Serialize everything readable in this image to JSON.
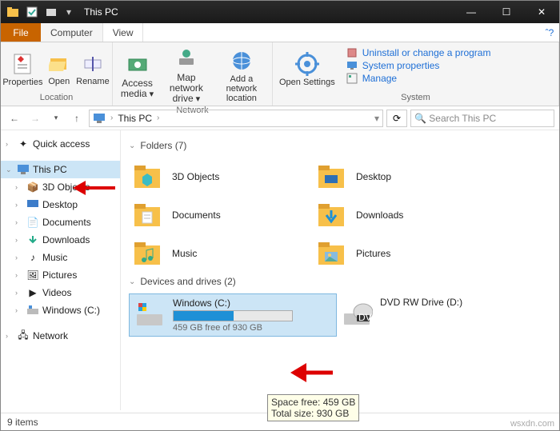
{
  "title": "This PC",
  "tabs": {
    "file": "File",
    "computer": "Computer",
    "view": "View"
  },
  "ribbon": {
    "location": {
      "label": "Location",
      "properties": "Properties",
      "open": "Open",
      "rename": "Rename"
    },
    "network": {
      "label": "Network",
      "access": "Access media",
      "map": "Map network drive",
      "add": "Add a network location"
    },
    "system": {
      "label": "System",
      "settings": "Open Settings",
      "uninstall": "Uninstall or change a program",
      "sysprops": "System properties",
      "manage": "Manage"
    }
  },
  "address": {
    "root": "This PC",
    "search_placeholder": "Search This PC"
  },
  "tree": {
    "quick": "Quick access",
    "thispc": "This PC",
    "3d": "3D Objects",
    "desktop": "Desktop",
    "documents": "Documents",
    "downloads": "Downloads",
    "music": "Music",
    "pictures": "Pictures",
    "videos": "Videos",
    "windows": "Windows (C:)",
    "network": "Network"
  },
  "sections": {
    "folders": "Folders (7)",
    "drives": "Devices and drives (2)"
  },
  "folders": {
    "3d": "3D Objects",
    "desktop": "Desktop",
    "documents": "Documents",
    "downloads": "Downloads",
    "music": "Music",
    "pictures": "Pictures"
  },
  "drives": {
    "c": {
      "name": "Windows (C:)",
      "free": "459 GB free of 930 GB",
      "fill": 51
    },
    "d": {
      "name": "DVD RW Drive (D:)"
    }
  },
  "tooltip": {
    "l1": "Space free: 459 GB",
    "l2": "Total size: 930 GB"
  },
  "status": "9 items",
  "watermark": "wsxdn.com"
}
